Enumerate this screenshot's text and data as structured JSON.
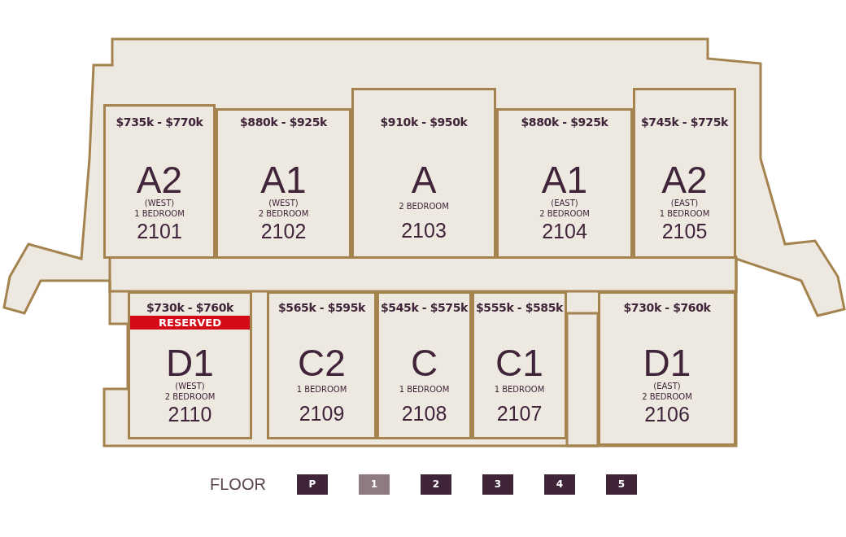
{
  "top_row": [
    {
      "number": "2101",
      "price": "$735k - $770k",
      "type": "A2",
      "wing": "(WEST)",
      "bedrooms": "1 BEDROOM",
      "reserved": false
    },
    {
      "number": "2102",
      "price": "$880k - $925k",
      "type": "A1",
      "wing": "(WEST)",
      "bedrooms": "2 BEDROOM",
      "reserved": false
    },
    {
      "number": "2103",
      "price": "$910k - $950k",
      "type": "A",
      "bedrooms": "2 BEDROOM",
      "reserved": false
    },
    {
      "number": "2104",
      "price": "$880k - $925k",
      "type": "A1",
      "wing": "(EAST)",
      "bedrooms": "2 BEDROOM",
      "reserved": false
    },
    {
      "number": "2105",
      "price": "$745k - $775k",
      "type": "A2",
      "wing": "(EAST)",
      "bedrooms": "1 BEDROOM",
      "reserved": false
    }
  ],
  "bottom_row": [
    {
      "number": "2110",
      "price": "$730k - $760k",
      "type": "D1",
      "wing": "(WEST)",
      "bedrooms": "2 BEDROOM",
      "reserved": true,
      "reserved_label": "RESERVED"
    },
    {
      "number": "2109",
      "price": "$565k - $595k",
      "type": "C2",
      "bedrooms": "1 BEDROOM",
      "reserved": false
    },
    {
      "number": "2108",
      "price": "$545k - $575k",
      "type": "C",
      "bedrooms": "1 BEDROOM",
      "reserved": false
    },
    {
      "number": "2107",
      "price": "$555k - $585k",
      "type": "C1",
      "bedrooms": "1 BEDROOM",
      "reserved": false
    },
    {
      "number": "2106",
      "price": "$730k - $760k",
      "type": "D1",
      "wing": "(EAST)",
      "bedrooms": "2 BEDROOM",
      "reserved": false
    }
  ],
  "floor_selector": {
    "label": "FLOOR",
    "floors": [
      {
        "label": "P",
        "selected": false
      },
      {
        "label": "1",
        "selected": true
      },
      {
        "label": "2",
        "selected": false
      },
      {
        "label": "3",
        "selected": false
      },
      {
        "label": "4",
        "selected": false
      },
      {
        "label": "5",
        "selected": false
      }
    ]
  }
}
